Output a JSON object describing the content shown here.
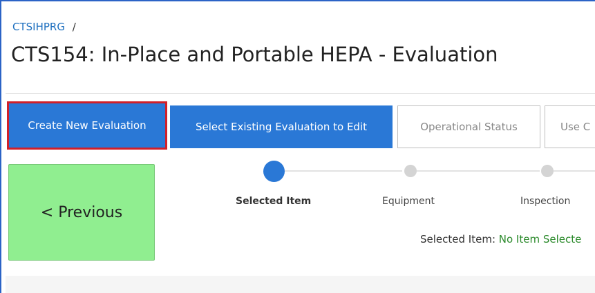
{
  "breadcrumb": {
    "link": "CTSIHPRG",
    "separator": "/"
  },
  "page": {
    "title": "CTS154: In-Place and Portable HEPA - Evaluation"
  },
  "toolbar": {
    "create_label": "Create New Evaluation",
    "select_label": "Select Existing Evaluation to Edit",
    "status_label": "Operational Status",
    "usec_label": "Use C"
  },
  "nav": {
    "previous_label": "< Previous"
  },
  "stepper": {
    "steps": [
      {
        "label": "Selected Item",
        "state": "active"
      },
      {
        "label": "Equipment",
        "state": "inactive"
      },
      {
        "label": "Inspection",
        "state": "inactive"
      }
    ]
  },
  "selection": {
    "label": "Selected Item: ",
    "value": "No Item Selecte"
  },
  "colors": {
    "primary": "#2a78d6",
    "highlight_border": "#d0202a",
    "previous_bg": "#90ee90",
    "selection_value": "#2b8a2b"
  }
}
